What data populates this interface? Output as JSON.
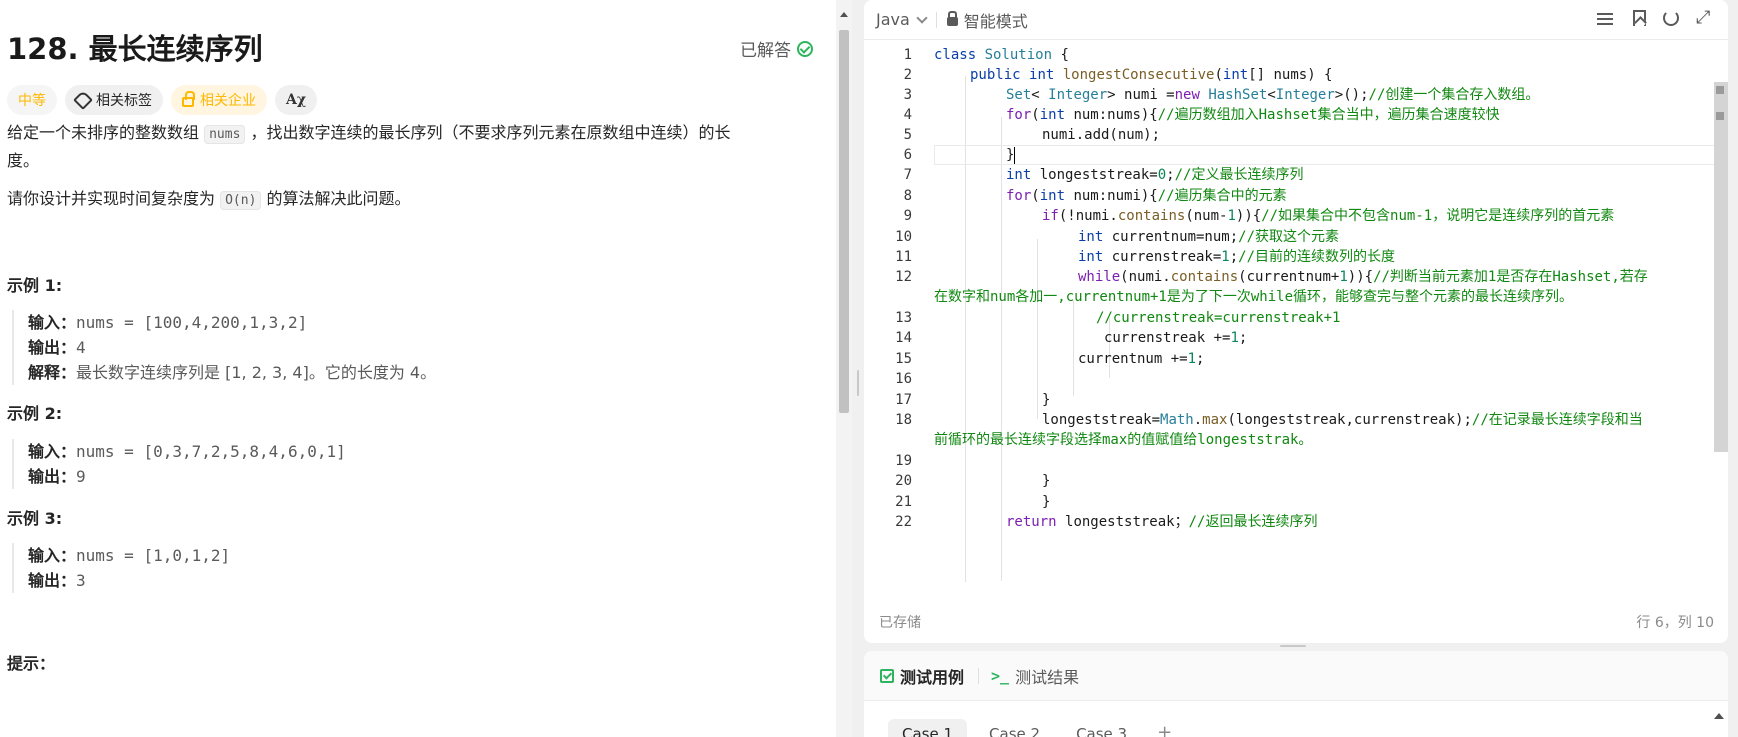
{
  "problem": {
    "title": "128. 最长连续序列",
    "status": "已解答",
    "tags": {
      "difficulty": "中等",
      "topics": "相关标签",
      "companies": "相关企业",
      "translate": "Aχ"
    },
    "desc1_a": "给定一个未排序的整数数组 ",
    "desc1_code": "nums",
    "desc1_b": " ，找出数字连续的最长序列（不要求序列元素在原数组中连续）的长",
    "desc1_c": "度。",
    "desc2_a": "请你设计并实现时间复杂度为 ",
    "desc2_code": "O(n)",
    "desc2_b": " 的算法解决此问题。",
    "examples": [
      {
        "title": "示例 1:",
        "input_label": "输入：",
        "input": "nums = [100,4,200,1,3,2]",
        "output_label": "输出：",
        "output": "4",
        "explain_label": "解释：",
        "explain": "最长数字连续序列是 [1, 2, 3, 4]。它的长度为 4。"
      },
      {
        "title": "示例 2:",
        "input_label": "输入：",
        "input": "nums = [0,3,7,2,5,8,4,6,0,1]",
        "output_label": "输出：",
        "output": "9"
      },
      {
        "title": "示例 3:",
        "input_label": "输入：",
        "input": "nums = [1,0,1,2]",
        "output_label": "输出：",
        "output": "3"
      }
    ],
    "hints_title": "提示："
  },
  "editor": {
    "language": "Java",
    "mode": "智能模式",
    "saved": "已存储",
    "cursor": "行 6，列 10",
    "lines": [
      "1",
      "2",
      "3",
      "4",
      "5",
      "6",
      "7",
      "8",
      "9",
      "10",
      "11",
      "12",
      "13",
      "14",
      "15",
      "16",
      "17",
      "18",
      "19",
      "20",
      "21",
      "22"
    ],
    "code": {
      "l1_a": "class ",
      "l1_b": "Solution",
      "l1_c": " {",
      "l2_a": "public ",
      "l2_b": "int ",
      "l2_c": "longestConsecutive",
      "l2_d": "(",
      "l2_e": "int",
      "l2_f": "[] nums) {",
      "l3_a": "Set",
      "l3_b": "< ",
      "l3_c": "Integer",
      "l3_d": "> numi =",
      "l3_e": "new ",
      "l3_f": "HashSet",
      "l3_g": "<",
      "l3_h": "Integer",
      "l3_i": ">();",
      "l3_cm": "//创建一个集合存入数组。",
      "l4_a": "for",
      "l4_b": "(",
      "l4_c": "int ",
      "l4_d": "num:nums){",
      "l4_cm": "//遍历数组加入Hashset集合当中，遍历集合速度较快",
      "l5": "numi.add(num);",
      "l6": "}",
      "l7_a": "int ",
      "l7_b": "longeststreak=",
      "l7_c": "0",
      "l7_d": ";",
      "l7_cm": "//定义最长连续序列",
      "l8_a": "for",
      "l8_b": "(",
      "l8_c": "int ",
      "l8_d": "num:numi){",
      "l8_cm": "//遍历集合中的元素",
      "l9_a": "if",
      "l9_b": "(!numi.",
      "l9_c": "contains",
      "l9_d": "(num-",
      "l9_e": "1",
      "l9_f": ")){",
      "l9_cm": "//如果集合中不包含num-1，说明它是连续序列的首元素",
      "l10_a": "int ",
      "l10_b": "currentnum=num;",
      "l10_cm": "//获取这个元素",
      "l11_a": "int ",
      "l11_b": "currenstreak=",
      "l11_c": "1",
      "l11_d": ";",
      "l11_cm": "//目前的连续数列的长度",
      "l12_a": "while",
      "l12_b": "(numi.",
      "l12_c": "contains",
      "l12_d": "(currentnum+",
      "l12_e": "1",
      "l12_f": ")){",
      "l12_cm": "//判断当前元素加1是否存在Hashset,若存",
      "l12_wrap": "在数字和num各加一,currentnum+1是为了下一次while循环，能够查完与整个元素的最长连续序列。",
      "l13_cm": "//currenstreak=currenstreak+1",
      "l14_a": "currenstreak +=",
      "l14_b": "1",
      "l14_c": ";",
      "l15_a": "currentnum +=",
      "l15_b": "1",
      "l15_c": ";",
      "l17": "}",
      "l18_a": "longeststreak=",
      "l18_b": "Math",
      "l18_c": ".",
      "l18_d": "max",
      "l18_e": "(longeststreak,currenstreak);",
      "l18_cm": "//在记录最长连续字段和当",
      "l18_wrap": "前循环的最长连续字段选择max的值赋值给longeststrak。",
      "l20": "}",
      "l21": "}",
      "l22_a": "return ",
      "l22_b": "longeststreak；",
      "l22_cm": "//返回最长连续序列"
    }
  },
  "test": {
    "tab_cases": "测试用例",
    "tab_result": "测试结果",
    "term_icon": ">_",
    "cases": [
      "Case 1",
      "Case 2",
      "Case 3"
    ],
    "add": "+"
  },
  "colors": {
    "accent_green": "#2db55d",
    "difficulty_medium": "#ffb800",
    "comment": "#118811",
    "keyword": "#7c1fb2"
  },
  "icons": [
    "check-circle-icon",
    "tag-icon",
    "lock-icon",
    "translate-icon",
    "chevron-down-icon",
    "format-icon",
    "bookmark-icon",
    "reset-icon",
    "expand-icon",
    "checkbox-icon",
    "terminal-icon",
    "plus-icon"
  ]
}
